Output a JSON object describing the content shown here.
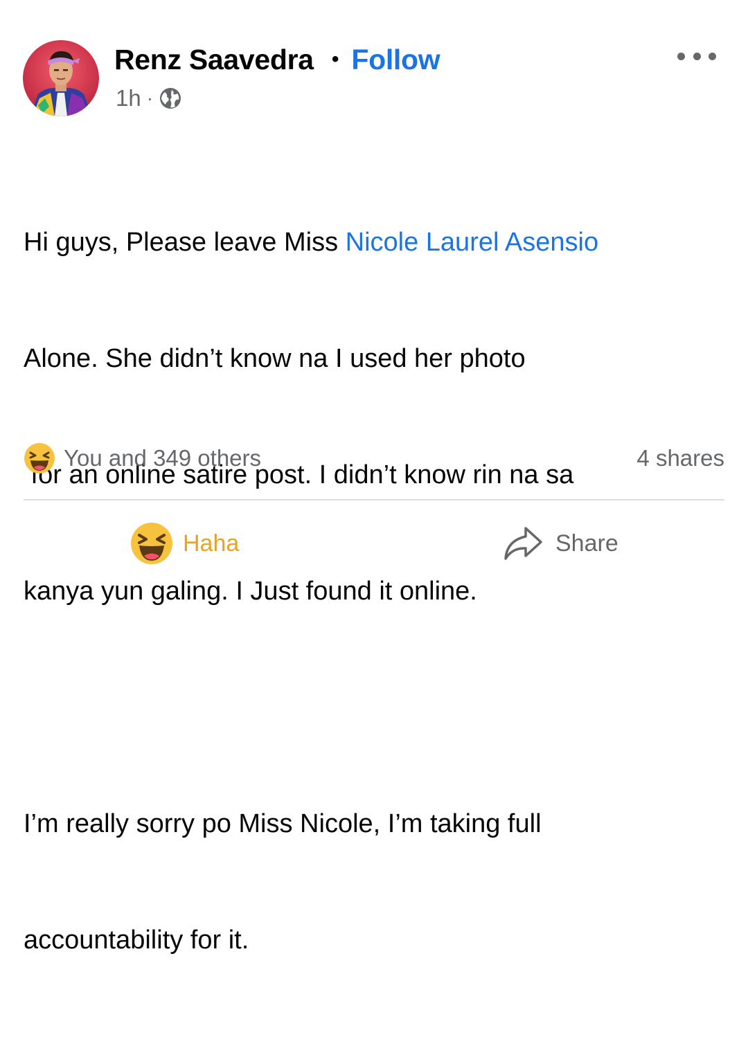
{
  "post": {
    "author": "Renz Saavedra",
    "separator": "•",
    "follow_label": "Follow",
    "timestamp": "1h",
    "meta_separator": "·",
    "privacy_icon": "globe-icon",
    "more_icon": "more-options-icon",
    "text": {
      "line1_before": "Hi guys, Please leave Miss ",
      "mention": "Nicole Laurel Asensio",
      "line2": "Alone. She didn’t know na I used her photo",
      "line3": " for an online satire post. I didn’t know rin na sa",
      "line4": "kanya yun galing. I Just found it online.",
      "line5": "I’m really sorry po Miss Nicole, I’m taking full",
      "line6": "accountability for it."
    }
  },
  "engagement": {
    "reaction_icon": "haha-reaction-icon",
    "reaction_count_text": "You and 349 others",
    "shares_text": "4 shares"
  },
  "actions": {
    "haha_label": "Haha",
    "share_label": "Share"
  },
  "colors": {
    "link_blue": "#1b74e4",
    "secondary_text": "#65676b",
    "haha_yellow": "#e5a426",
    "divider": "#dadde1"
  }
}
